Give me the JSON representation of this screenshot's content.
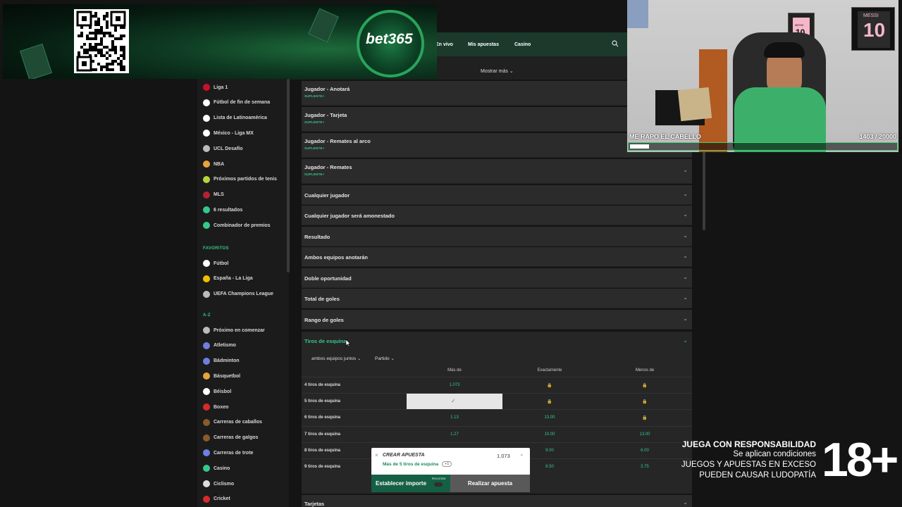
{
  "banner": {
    "brand": "bet365"
  },
  "topnav": {
    "items": [
      "En vivo",
      "Mis apuestas",
      "Casino"
    ],
    "more": "Mostrar más",
    "search_icon": "search-icon"
  },
  "sidebar": {
    "items": [
      {
        "label": "Liga 1",
        "icon": "flag-peru-icon",
        "color": "#c8102e"
      },
      {
        "label": "Fútbol de fin de semana",
        "icon": "soccer-ball-icon",
        "color": "#ffffff"
      },
      {
        "label": "Lista de Latinoamérica",
        "icon": "soccer-ball-icon",
        "color": "#ffffff"
      },
      {
        "label": "México - Liga MX",
        "icon": "soccer-ball-icon",
        "color": "#ffffff"
      },
      {
        "label": "UCL Desafío",
        "icon": "trophy-icon",
        "color": "#bbbbbb"
      },
      {
        "label": "NBA",
        "icon": "basketball-icon",
        "color": "#e8a33c"
      },
      {
        "label": "Próximos partidos de tenis",
        "icon": "tennis-ball-icon",
        "color": "#b7d33c"
      },
      {
        "label": "MLS",
        "icon": "flag-usa-icon",
        "color": "#b22234"
      },
      {
        "label": "6 resultados",
        "icon": "target-icon",
        "color": "#35c88a"
      },
      {
        "label": "Combinador de premios",
        "icon": "combo-icon",
        "color": "#35c88a"
      }
    ],
    "favorites_heading": "FAVORITOS",
    "favorites": [
      {
        "label": "Fútbol",
        "icon": "soccer-ball-icon",
        "color": "#ffffff"
      },
      {
        "label": "España - La Liga",
        "icon": "flag-spain-icon",
        "color": "#f1bf00"
      },
      {
        "label": "UEFA Champions League",
        "icon": "trophy-icon",
        "color": "#bbbbbb"
      }
    ],
    "az_heading": "A-Z",
    "az": [
      {
        "label": "Próximo en comenzar",
        "icon": "clock-arrow-icon",
        "color": "#bbbbbb"
      },
      {
        "label": "Atletismo",
        "icon": "running-shoe-icon",
        "color": "#6f7fe0"
      },
      {
        "label": "Bádminton",
        "icon": "shuttlecock-icon",
        "color": "#6f7fe0"
      },
      {
        "label": "Básquetbol",
        "icon": "basketball-icon",
        "color": "#e8a33c"
      },
      {
        "label": "Béisbol",
        "icon": "baseball-icon",
        "color": "#ffffff"
      },
      {
        "label": "Boxeo",
        "icon": "boxing-glove-icon",
        "color": "#d62b2b"
      },
      {
        "label": "Carreras de caballos",
        "icon": "horse-icon",
        "color": "#8a5a2b"
      },
      {
        "label": "Carreras de galgos",
        "icon": "greyhound-icon",
        "color": "#8a5a2b"
      },
      {
        "label": "Carreras de trote",
        "icon": "trotting-icon",
        "color": "#6f7fe0"
      },
      {
        "label": "Casino",
        "icon": "casino-icon",
        "color": "#35c88a"
      },
      {
        "label": "Ciclismo",
        "icon": "bicycle-icon",
        "color": "#dddddd"
      },
      {
        "label": "Cricket",
        "icon": "cricket-icon",
        "color": "#d62b2b"
      }
    ]
  },
  "markets": [
    {
      "title": "Jugador - Anotará",
      "badge": "SUPLENTE+"
    },
    {
      "title": "Jugador - Tarjeta",
      "badge": "SUPLENTE+"
    },
    {
      "title": "Jugador - Remates al arco",
      "badge": "SUPLENTE+"
    },
    {
      "title": "Jugador - Remates",
      "badge": "SUPLENTE+"
    },
    {
      "title": "Cualquier jugador",
      "badge": ""
    },
    {
      "title": "Cualquier jugador será amonestado",
      "badge": ""
    },
    {
      "title": "Resultado",
      "badge": ""
    },
    {
      "title": "Ambos equipos anotarán",
      "badge": ""
    },
    {
      "title": "Doble oportunidad",
      "badge": ""
    },
    {
      "title": "Total de goles",
      "badge": ""
    },
    {
      "title": "Rango de goles",
      "badge": ""
    }
  ],
  "corners": {
    "title": "Tiros de esquina",
    "filters": [
      "ambos equipos juntos",
      "Partido"
    ],
    "columns": [
      "Más de",
      "Exactamente",
      "Menos de"
    ],
    "rows": [
      {
        "label": "4 tiros de esquina",
        "mas": "1.073",
        "exact": "",
        "menos": ""
      },
      {
        "label": "5 tiros de esquina",
        "mas": "",
        "exact": "",
        "menos": ""
      },
      {
        "label": "6 tiros de esquina",
        "mas": "1.13",
        "exact": "13.00",
        "menos": ""
      },
      {
        "label": "7 tiros de esquina",
        "mas": "1.27",
        "exact": "10.00",
        "menos": "13.00"
      },
      {
        "label": "8 tiros de esquina",
        "mas": "",
        "exact": "9.00",
        "menos": "6.00"
      },
      {
        "label": "9 tiros de esquina",
        "mas": "",
        "exact": "8.50",
        "menos": "3.75"
      }
    ]
  },
  "betslip": {
    "title": "CREAR APUESTA",
    "odds": "1.073",
    "selection": "Más de 5 tiros de esquina",
    "count": "+1",
    "stake_label": "Establecer importe",
    "recordar": "Recordar",
    "place_label": "Realizar apuesta"
  },
  "next_market": "Tarjetas",
  "webcam": {
    "goal_label": "ME RAPO EL CABELLO",
    "goal_count": "1403  / 20000",
    "goal_progress": 0.07015,
    "jersey_text": "MESSI",
    "jersey_number": "10"
  },
  "responsibility": {
    "line1": "JUEGA CON RESPONSABILIDAD",
    "line2": "Se aplican condiciones",
    "line3": "JUEGOS Y APUESTAS EN EXCESO",
    "line4": "PUEDEN CAUSAR LUDOPATÍA",
    "age": "18+"
  }
}
